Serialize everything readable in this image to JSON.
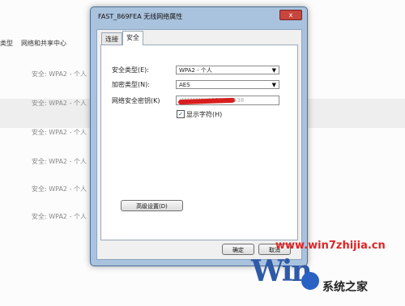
{
  "background": {
    "col1": "类型",
    "col2": "网络和共享中心",
    "rows": [
      "安全: WPA2 - 个人",
      "安全: WPA2 - 个人",
      "安全: WPA2 - 个人",
      "安全: WPA2 - 个人",
      "安全: WPA2 - 个人",
      "安全: WPA2 - 个人"
    ]
  },
  "dialog": {
    "title": "FAST_869FEA 无线网络属性",
    "close": "x",
    "tabs": [
      "连接",
      "安全"
    ],
    "security_type_label": "安全类型(E):",
    "security_type_value": "WPA2 - 个人",
    "encryption_type_label": "加密类型(N):",
    "encryption_type_value": "AES",
    "key_label": "网络安全密钥(K)",
    "key_value": "WWWWW1552056538",
    "show_chars_label": "显示字符(H)",
    "show_chars_checked": "✓",
    "advanced_button": "高级设置(D)",
    "ok_button": "确定",
    "cancel_button": "取消"
  },
  "watermark": {
    "url": "www.win7zhijia.cn",
    "brand": "Win",
    "site": "系统之家"
  }
}
